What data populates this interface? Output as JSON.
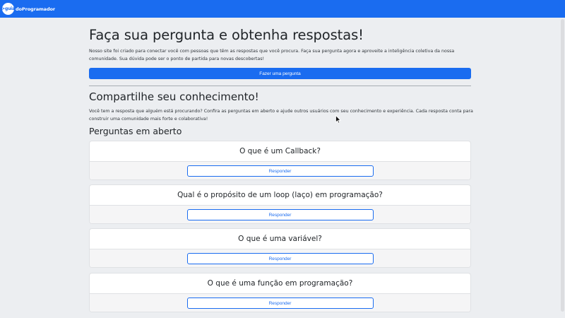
{
  "navbar": {
    "logo_mark": ">guia",
    "logo_text": "doProgramador"
  },
  "hero": {
    "title": "Faça sua pergunta e obtenha respostas!",
    "description": "Nosso site foi criado para conectar você com pessoas que têm as respostas que você procura. Faça sua pergunta agora e aproveite a inteligência coletiva da nossa comunidade. Sua dúvida pode ser o ponto de partida para novas descobertas!",
    "ask_button": "Fazer uma pergunta"
  },
  "share": {
    "title": "Compartilhe seu conhecimento!",
    "description": "Você tem a resposta que alguém está procurando? Confira as perguntas em aberto e ajude outros usuários com seu conhecimento e experiência. Cada resposta conta para construir uma comunidade mais forte e colaborativa!"
  },
  "open_questions": {
    "title": "Perguntas em aberto",
    "answer_label": "Responder",
    "items": [
      {
        "question": "O que é um Callback?"
      },
      {
        "question": "Qual é o propósito de um loop (laço) em programação?"
      },
      {
        "question": "O que é uma variável?"
      },
      {
        "question": "O que é uma função em programação?"
      }
    ]
  },
  "colors": {
    "primary": "#1a6cf0",
    "background": "#eceef1"
  }
}
